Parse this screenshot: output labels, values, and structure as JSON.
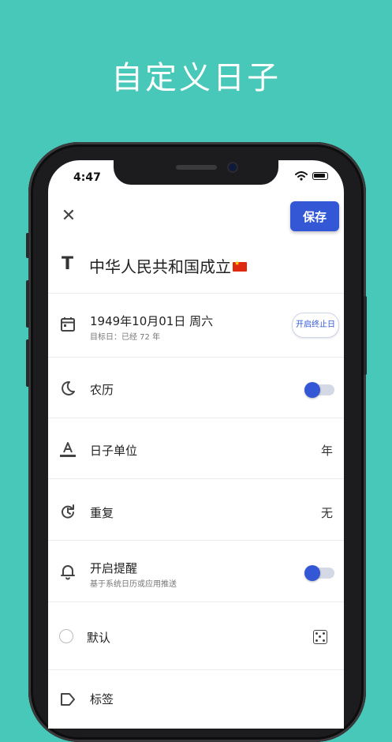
{
  "headline": "自定义日子",
  "status_bar": {
    "time": "4:47"
  },
  "toolbar": {
    "close_label": "✕",
    "save_label": "保存"
  },
  "title": {
    "text": "中华人民共和国成立"
  },
  "date_row": {
    "date": "1949年10月01日 周六",
    "sub": "目标日：已经 72 年",
    "end_button": "开启终止日"
  },
  "lunar_row": {
    "label": "农历",
    "enabled": true
  },
  "unit_row": {
    "label": "日子单位",
    "value": "年"
  },
  "repeat_row": {
    "label": "重复",
    "value": "无"
  },
  "reminder_row": {
    "label": "开启提醒",
    "sub": "基于系统日历或应用推送",
    "enabled": true
  },
  "default_row": {
    "label": "默认"
  },
  "tag_row": {
    "label": "标签"
  },
  "colors": {
    "background": "#48c8b9",
    "accent": "#3457d5"
  }
}
